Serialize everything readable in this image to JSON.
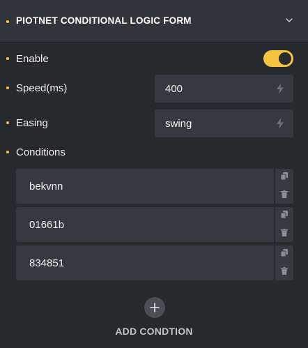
{
  "header": {
    "title": "PIOTNET CONDITIONAL LOGIC FORM",
    "chevron_icon": "chevron-down-icon"
  },
  "fields": {
    "enable": {
      "label": "Enable",
      "toggle_on": true
    },
    "speed": {
      "label": "Speed(ms)",
      "value": "400",
      "icon": "bolt-icon"
    },
    "easing": {
      "label": "Easing",
      "value": "swing",
      "icon": "bolt-icon"
    },
    "conditions": {
      "label": "Conditions"
    }
  },
  "conditions": [
    {
      "value": "bekvnn"
    },
    {
      "value": "01661b"
    },
    {
      "value": "834851"
    }
  ],
  "add": {
    "icon": "plus-icon",
    "label": "ADD CONDTION"
  },
  "colors": {
    "accent": "#f5c542",
    "panel": "#26292d",
    "field": "#363a40"
  }
}
